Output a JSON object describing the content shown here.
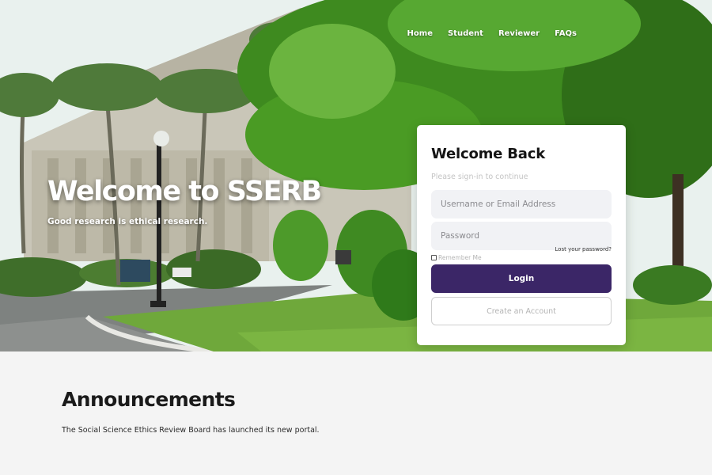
{
  "nav": {
    "items": [
      {
        "label": "Home"
      },
      {
        "label": "Student"
      },
      {
        "label": "Reviewer"
      },
      {
        "label": "FAQs"
      }
    ]
  },
  "hero": {
    "title": "Welcome to SSERB",
    "subtitle": "Good research is ethical research."
  },
  "login": {
    "title": "Welcome Back",
    "subtitle": "Please sign-in to continue",
    "username_placeholder": "Username or Email Address",
    "password_placeholder": "Password",
    "lost_password": "Lost your password?",
    "remember_me": "Remember Me",
    "login_button": "Login",
    "create_account_button": "Create an Account",
    "accent_color": "#3b2667"
  },
  "announcements": {
    "title": "Announcements",
    "text": "The Social Science Ethics Review Board has launched its new portal."
  }
}
